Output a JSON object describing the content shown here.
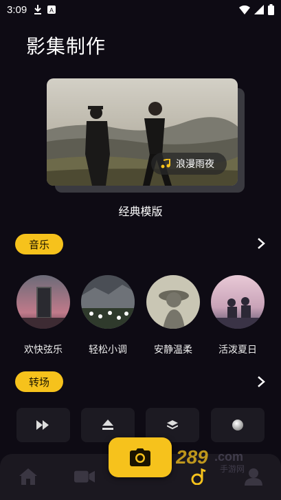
{
  "status": {
    "time": "3:09"
  },
  "page_title": "影集制作",
  "hero": {
    "song_label": "浪漫雨夜",
    "template_label": "经典模版"
  },
  "sections": {
    "music": "音乐",
    "transition": "转场"
  },
  "music_items": [
    {
      "label": "欢快弦乐"
    },
    {
      "label": "轻松小调"
    },
    {
      "label": "安静温柔"
    },
    {
      "label": "活泼夏日"
    }
  ],
  "transitions": [
    "fast-forward-icon",
    "eject-icon",
    "layers-icon",
    "circle-icon"
  ],
  "nav": [
    "home-icon",
    "video-icon",
    "music-note-icon",
    "profile-icon"
  ],
  "watermark": {
    "text": "289",
    "suffix": ".com",
    "sub": "手游网"
  },
  "colors": {
    "accent": "#f6c21c",
    "background": "#0e0b14",
    "nav": "#1b1820"
  }
}
